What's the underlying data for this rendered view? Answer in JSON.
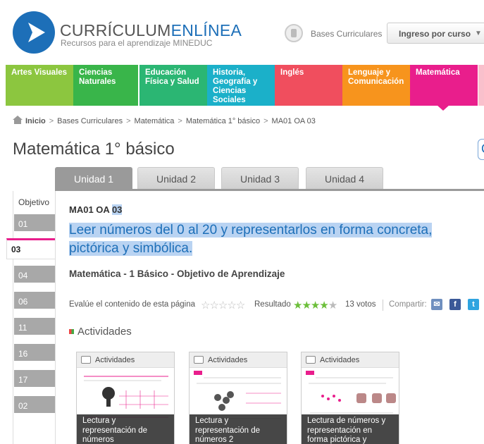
{
  "header": {
    "logo_title_a": "CURRÍCULUM",
    "logo_title_b": "ENLÍNEA",
    "logo_subtitle": "Recursos para el aprendizaje MINEDUC",
    "bases_label": "Bases Curriculares",
    "ingreso_label": "Ingreso por curso"
  },
  "subjects": [
    {
      "label": "Artes Visuales",
      "color": "#8cc63f"
    },
    {
      "label": "Ciencias Naturales",
      "color": "#39b54a"
    },
    {
      "label": "Educación Física y Salud",
      "color": "#2bb673"
    },
    {
      "label": "Historia, Geografía y Ciencias Sociales",
      "color": "#1bb0c9"
    },
    {
      "label": "Inglés",
      "color": "#f04e5e"
    },
    {
      "label": "Lenguaje y Comunicación",
      "color": "#f7941d"
    },
    {
      "label": "Matemática",
      "color": "#e91e8c"
    }
  ],
  "breadcrumb": {
    "home": "Inicio",
    "items": [
      "Bases Curriculares",
      "Matemática",
      "Matemática 1° básico",
      "MA01 OA 03"
    ]
  },
  "page_title": "Matemática 1° básico",
  "unit_tabs": [
    "Unidad 1",
    "Unidad 2",
    "Unidad 3",
    "Unidad 4"
  ],
  "objectives": {
    "header": "Objetivo",
    "items": [
      "01",
      "03",
      "04",
      "06",
      "11",
      "16",
      "17",
      "02"
    ],
    "active": "03"
  },
  "objective": {
    "code_prefix": "MA01 OA",
    "code_num": "03",
    "text": "Leer números del 0 al 20 y representarlos en forma concreta, pictórica y simbólica.",
    "subtitle": "Matemática - 1 Básico - Objetivo de Aprendizaje"
  },
  "rating": {
    "evaluate_label": "Evalúe el contenido de esta página",
    "result_label": "Resultado",
    "votes": "13 votos",
    "score": 4,
    "max": 5,
    "share_label": "Compartir:"
  },
  "activities": {
    "heading": "Actividades",
    "cards": [
      {
        "header": "Actividades",
        "title": "Lectura y representación de números"
      },
      {
        "header": "Actividades",
        "title": "Lectura y representación de números 2"
      },
      {
        "header": "Actividades",
        "title": "Lectura de números y representación en forma pictórica y simbólica"
      }
    ]
  }
}
